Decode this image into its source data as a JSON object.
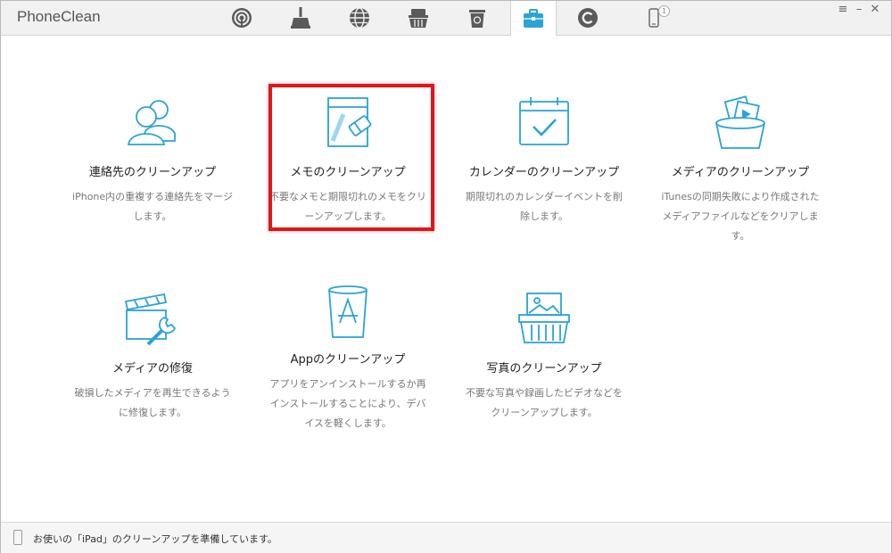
{
  "app": {
    "title": "PhoneClean"
  },
  "toolbar": {
    "tabs": [
      {
        "icon": "signal-icon",
        "active": false
      },
      {
        "icon": "broom-icon",
        "active": false
      },
      {
        "icon": "globe-icon",
        "active": false
      },
      {
        "icon": "basket-icon",
        "active": false
      },
      {
        "icon": "trash-icon",
        "active": false
      },
      {
        "icon": "toolbox-icon",
        "active": true
      },
      {
        "icon": "refresh-c-icon",
        "active": false
      },
      {
        "icon": "phone-icon",
        "active": false,
        "badge": "1"
      }
    ],
    "menu_glyph": "≡",
    "minimize_glyph": "–",
    "close_glyph": "✕"
  },
  "accent_color": "#2aa3d6",
  "highlight_color": "#e0161b",
  "tools": [
    {
      "icon": "contacts-icon",
      "title": "連絡先のクリーンアップ",
      "desc": "iPhone内の重複する連絡先をマージします。"
    },
    {
      "icon": "notes-eraser-icon",
      "title": "メモのクリーンアップ",
      "desc": "不要なメモと期限切れのメモをクリーンアップします。"
    },
    {
      "icon": "calendar-check-icon",
      "title": "カレンダーのクリーンアップ",
      "desc": "期限切れのカレンダーイベントを削除します。"
    },
    {
      "icon": "media-basket-icon",
      "title": "メディアのクリーンアップ",
      "desc": "iTunesの同期失敗により作成されたメディアファイルなどをクリアします。"
    },
    {
      "icon": "clapper-wrench-icon",
      "title": "メディアの修復",
      "desc": "破損したメディアを再生できるように修復します。"
    },
    {
      "icon": "app-trash-icon",
      "title": "Appのクリーンアップ",
      "desc": "アプリをアンインストールするか再インストールすることにより、デバイスを軽くします。"
    },
    {
      "icon": "photo-basket-icon",
      "title": "写真のクリーンアップ",
      "desc": "不要な写真や録画したビデオなどをクリーンアップします。"
    }
  ],
  "status": {
    "text": "お使いの「iPad」のクリーンアップを準備しています。"
  }
}
